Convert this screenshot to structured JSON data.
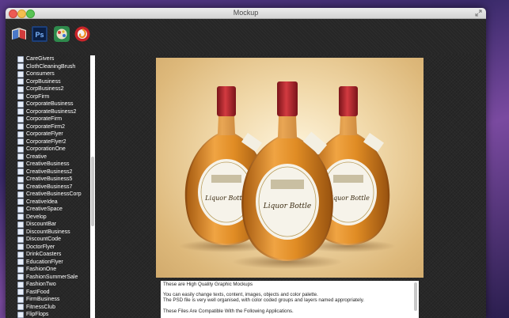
{
  "window": {
    "title": "Mockup"
  },
  "toolbar": {
    "icons": [
      "book-icon",
      "photoshop-icon",
      "game-icon",
      "swirl-icon"
    ]
  },
  "sidebar": {
    "items": [
      "CareGivers",
      "ClothCleaningBrush",
      "Consumers",
      "CorpBusiness",
      "CorpBusiness2",
      "CorpFirm",
      "CorporateBusiness",
      "CorporateBusiness2",
      "CorporateFirm",
      "CorporateFirm2",
      "CorporateFlyer",
      "CorporateFlyer2",
      "CorporationOne",
      "Creative",
      "CreativeBusiness",
      "CreativeBusiness2",
      "CreativeBusiness5",
      "CreativeBusiness7",
      "CreativeBusinessCorp",
      "CreativeIdea",
      "CreativeSpace",
      "Develop",
      "DiscountBar",
      "DiscountBusiness",
      "DiscountCode",
      "DoctorFlyer",
      "DrinkCoasters",
      "EducationFlyer",
      "FashionOne",
      "FashionSummerSale",
      "FashionTwo",
      "FastFood",
      "FirmBusiness",
      "FitnessClub",
      "FlipFlops"
    ]
  },
  "preview": {
    "label_main": "Liquor Bottle",
    "colors": {
      "background": "#f1d9aa",
      "liquor": "#d88a1e",
      "cap": "#b0202a"
    }
  },
  "description": {
    "lines": [
      "These are High Quality Graphic Mockups",
      "",
      "You can easily change texts, content, images, objects and color palette.",
      "The PSD file is very well organised, with color coded groups and layers named appropriately.",
      "",
      "These Files Are Compatible With the Following Applications."
    ]
  }
}
